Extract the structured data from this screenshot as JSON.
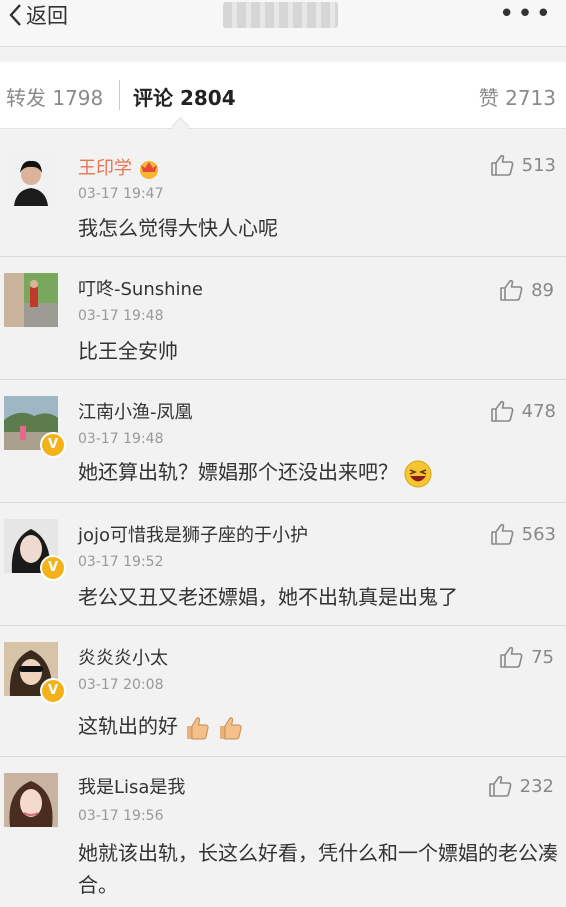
{
  "nav": {
    "back_label": "返回",
    "more_label": "•••"
  },
  "tabs": {
    "repost": "转发 1798",
    "comment": "评论 2804",
    "like": "赞 2713"
  },
  "comments": [
    {
      "name": "王印学",
      "time": "03-17 19:47",
      "text": "我怎么觉得大快人心呢",
      "likes": "513"
    },
    {
      "name": "叮咚-Sunshine",
      "time": "03-17 19:48",
      "text": "比王全安帅",
      "likes": "89"
    },
    {
      "name": "江南小渔-凤凰",
      "time": "03-17 19:48",
      "text": "她还算出轨？嫖娼那个还没出来吧？",
      "likes": "478"
    },
    {
      "name": "jojo可惜我是狮子座的于小护",
      "time": "03-17 19:52",
      "text": "老公又丑又老还嫖娼，她不出轨真是出鬼了",
      "likes": "563"
    },
    {
      "name": "炎炎炎小太",
      "time": "03-17 20:08",
      "text": "这轨出的好",
      "likes": "75"
    },
    {
      "name": "我是Lisa是我",
      "time": "03-17 19:56",
      "text": "她就该出轨，长这么好看，凭什么和一个嫖娼的老公凑合。",
      "likes": "232"
    }
  ],
  "icons": {
    "back": "chevron-left-icon",
    "more": "more-dots-icon",
    "like": "thumbs-up-icon",
    "verified": "verified-badge-icon"
  },
  "colors": {
    "vip_name": "#eb7350",
    "verified": "#f3b21a"
  }
}
